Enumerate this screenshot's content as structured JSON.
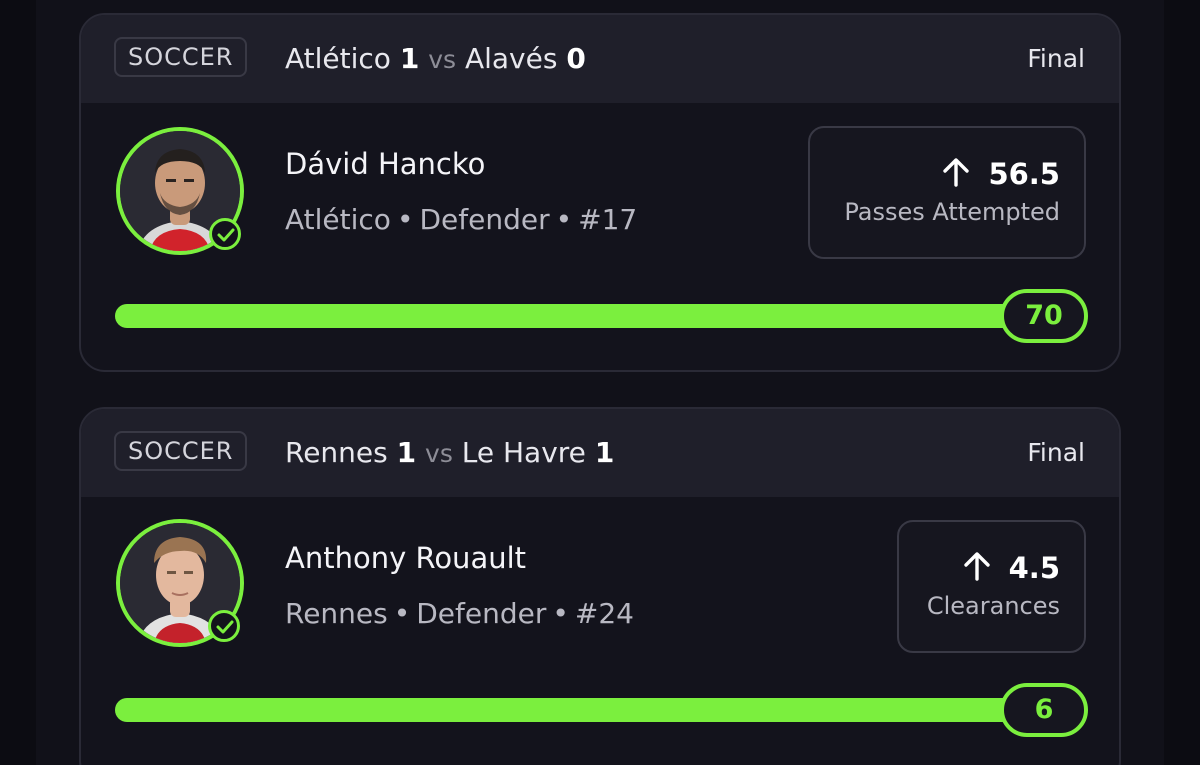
{
  "colors": {
    "accent": "#7bef3e",
    "card_bg": "#13131c",
    "header_bg": "#1f1f2a",
    "page_bg": "#0c0c12"
  },
  "cards": [
    {
      "sport": "SOCCER",
      "home_team": "Atlético",
      "home_score": "1",
      "vs": "vs",
      "away_team": "Alavés",
      "away_score": "0",
      "status": "Final",
      "player_name": "Dávid Hancko",
      "player_team": "Atlético",
      "position": "Defender",
      "number": "#17",
      "direction_icon": "arrow-up-icon",
      "prop_line": "56.5",
      "prop_stat": "Passes Attempted",
      "result": "70",
      "progress_fraction": 1.0,
      "avatar_verified": true
    },
    {
      "sport": "SOCCER",
      "home_team": "Rennes",
      "home_score": "1",
      "vs": "vs",
      "away_team": "Le Havre",
      "away_score": "1",
      "status": "Final",
      "player_name": "Anthony Rouault",
      "player_team": "Rennes",
      "position": "Defender",
      "number": "#24",
      "direction_icon": "arrow-up-icon",
      "prop_line": "4.5",
      "prop_stat": "Clearances",
      "result": "6",
      "progress_fraction": 1.0,
      "avatar_verified": true
    }
  ]
}
